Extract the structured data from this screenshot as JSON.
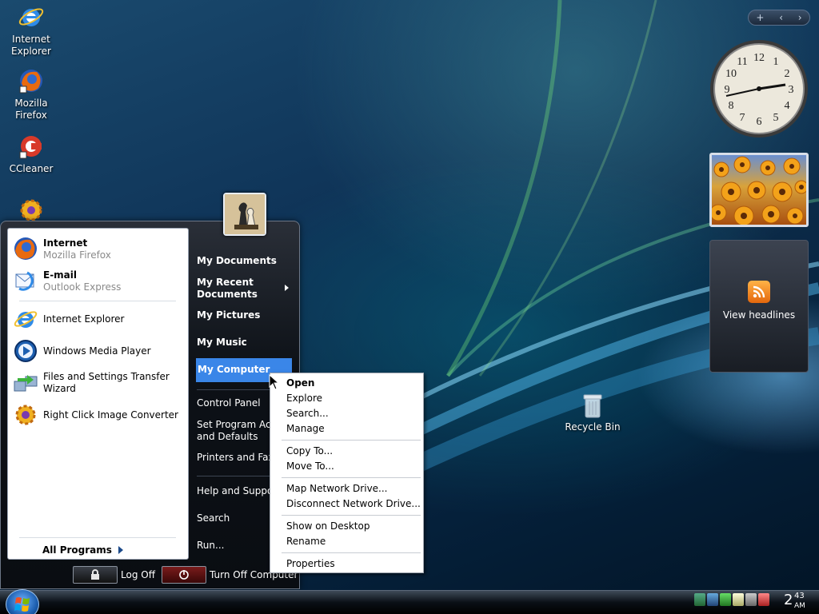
{
  "desktop": {
    "icons": [
      {
        "label_line1": "Internet",
        "label_line2": "Explorer",
        "icon": "internet-explorer-icon"
      },
      {
        "label_line1": "Mozilla",
        "label_line2": "Firefox",
        "icon": "firefox-icon"
      },
      {
        "label_line1": "CCleaner",
        "label_line2": "",
        "icon": "ccleaner-icon"
      },
      {
        "label_line1": "",
        "label_line2": "",
        "icon": "converter-icon"
      }
    ],
    "recycle_bin": "Recycle Bin"
  },
  "gadgets": {
    "bar": {
      "add": "+",
      "prev": "‹",
      "next": "›"
    },
    "clock": {
      "numbers": [
        "12",
        "1",
        "2",
        "3",
        "4",
        "5",
        "6",
        "7",
        "8",
        "9",
        "10",
        "11"
      ]
    },
    "feed": {
      "label": "View headlines"
    }
  },
  "start_menu": {
    "pinned": [
      {
        "title": "Internet",
        "subtitle": "Mozilla Firefox",
        "icon": "firefox-icon"
      },
      {
        "title": "E-mail",
        "subtitle": "Outlook Express",
        "icon": "outlook-express-icon"
      }
    ],
    "recent": [
      {
        "title": "Internet Explorer",
        "icon": "internet-explorer-icon"
      },
      {
        "title": "Windows Media Player",
        "icon": "media-player-icon"
      },
      {
        "title": "Files and Settings Transfer Wizard",
        "icon": "transfer-wizard-icon"
      },
      {
        "title": "Right Click Image Converter",
        "icon": "converter-icon"
      }
    ],
    "all_programs": "All Programs",
    "right": {
      "my_documents": "My Documents",
      "my_recent_line1": "My Recent",
      "my_recent_line2": "Documents",
      "my_pictures": "My Pictures",
      "my_music": "My Music",
      "my_computer": "My Computer",
      "control_panel": "Control Panel",
      "set_program_line1": "Set Program Acc",
      "set_program_line2": "and Defaults",
      "printers": "Printers and Faxe",
      "help": "Help and Suppor",
      "search": "Search",
      "run": "Run..."
    },
    "log_off": "Log Off",
    "turn_off": "Turn Off Computer"
  },
  "context_menu": {
    "groups": [
      [
        "Open",
        "Explore",
        "Search...",
        "Manage"
      ],
      [
        "Copy To...",
        "Move To..."
      ],
      [
        "Map Network Drive...",
        "Disconnect Network Drive..."
      ],
      [
        "Show on Desktop",
        "Rename"
      ],
      [
        "Properties"
      ]
    ]
  },
  "taskbar": {
    "clock_hour": "2",
    "clock_minute": "43",
    "clock_ampm": "AM"
  }
}
